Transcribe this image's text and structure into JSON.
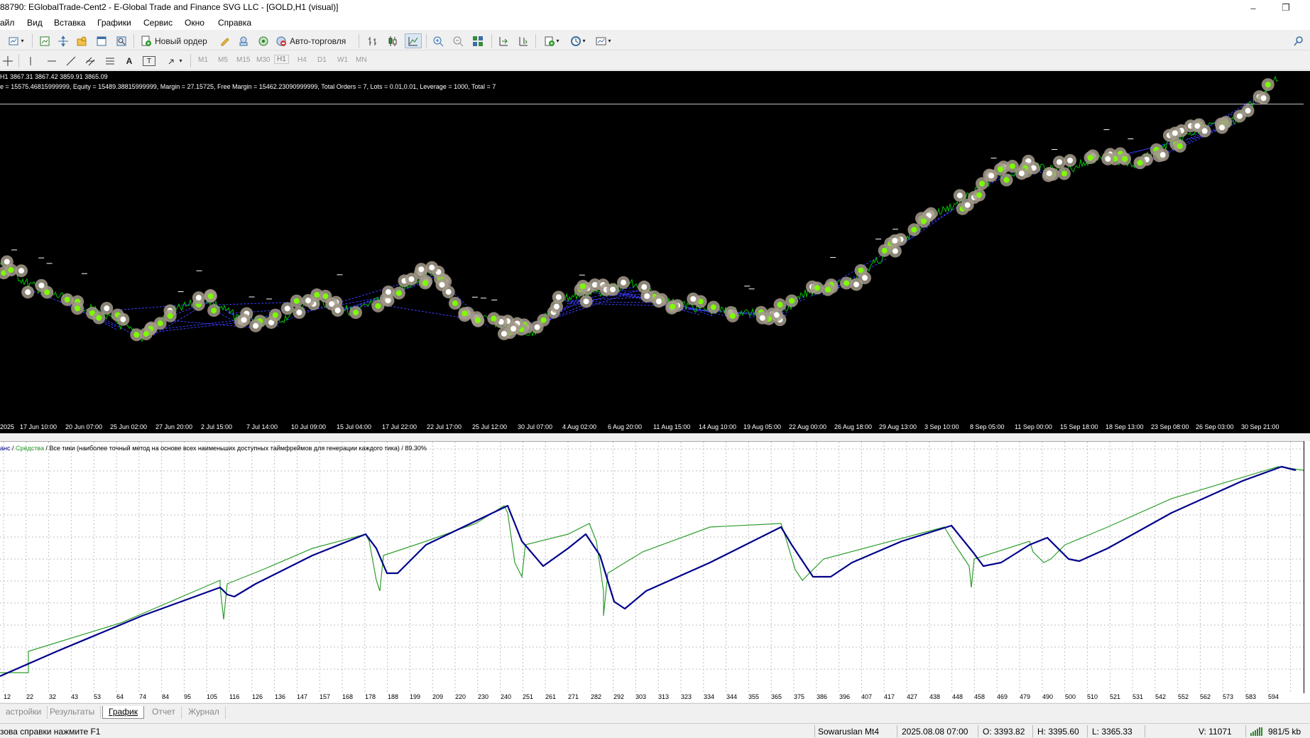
{
  "window": {
    "title": "88790: EGlobalTrade-Cent2 - E-Global Trade and Finance SVG LLC - [GOLD,H1 (visual)]",
    "minimize": "–",
    "restore": "❐"
  },
  "menu": [
    "айл",
    "Вид",
    "Вставка",
    "Графики",
    "Сервис",
    "Окно",
    "Справка"
  ],
  "toolbar": {
    "new_order": "Новый ордер",
    "auto_trading": "Авто-торговля",
    "icons": [
      "new-chart-icon",
      "profiles-icon",
      "market-watch-icon",
      "navigator-icon",
      "data-window-icon",
      "terminal-icon",
      "strategy-tester-icon",
      "meta-editor-icon",
      "bar-chart-icon",
      "candle-chart-icon",
      "line-chart-icon",
      "zoom-in-icon",
      "zoom-out-icon",
      "tile-icon",
      "autoscroll-icon",
      "chart-shift-icon",
      "indicators-icon",
      "periods-icon",
      "templates-icon",
      "search-icon"
    ]
  },
  "drawing_toolbar": {
    "text_tool": "A",
    "label_tool": "T",
    "timeframes": [
      "M1",
      "M5",
      "M15",
      "M30",
      "H1",
      "H4",
      "D1",
      "W1",
      "MN"
    ],
    "active_timeframe": "H1"
  },
  "chart": {
    "ohlc": "H1  3867.31 3867.42 3859.91 3865.09",
    "account_line": "e = 15575.46815999999, Equity = 15489.38815999999, Margin = 27.15725, Free Margin = 15462.23090999999, Total Orders = 7, Lots = 0.01,0.01, Leverage = 1000, Total = 7",
    "time_labels": [
      "2025",
      "17 Jun 10:00",
      "20 Jun 07:00",
      "25 Jun 02:00",
      "27 Jun 20:00",
      "2 Jul 15:00",
      "7 Jul 14:00",
      "10 Jul 09:00",
      "15 Jul 04:00",
      "17 Jul 22:00",
      "22 Jul 17:00",
      "25 Jul 12:00",
      "30 Jul 07:00",
      "4 Aug 02:00",
      "6 Aug 20:00",
      "11 Aug 15:00",
      "14 Aug 10:00",
      "19 Aug 05:00",
      "22 Aug 00:00",
      "26 Aug 18:00",
      "29 Aug 13:00",
      "3 Sep 10:00",
      "8 Sep 05:00",
      "11 Sep 00:00",
      "15 Sep 18:00",
      "18 Sep 13:00",
      "23 Sep 08:00",
      "26 Sep 03:00",
      "30 Sep 21:00"
    ],
    "colors": {
      "background": "#000000",
      "price_line": "#00c000",
      "orders": "#3b3bff",
      "marker": "#a39a8a"
    }
  },
  "equity": {
    "legend_balance": "анс",
    "legend_sep1": " / ",
    "legend_equity": "Средства",
    "legend_rest": " / Все тики (наиболее точный метод на основе всех наименьших доступных таймфреймов для генерации каждого тика) / 89.30%",
    "x_labels": [
      "12",
      "22",
      "32",
      "43",
      "53",
      "64",
      "74",
      "84",
      "95",
      "105",
      "116",
      "126",
      "136",
      "147",
      "157",
      "168",
      "178",
      "188",
      "199",
      "209",
      "220",
      "230",
      "240",
      "251",
      "261",
      "271",
      "282",
      "292",
      "303",
      "313",
      "323",
      "334",
      "344",
      "355",
      "365",
      "375",
      "386",
      "396",
      "407",
      "417",
      "427",
      "438",
      "448",
      "458",
      "469",
      "479",
      "490",
      "500",
      "510",
      "521",
      "531",
      "542",
      "552",
      "562",
      "573",
      "583",
      "594"
    ],
    "colors": {
      "balance": "#00008b",
      "equity": "#2e9e2e"
    }
  },
  "tabs": [
    "астройки",
    "Результаты",
    "График",
    "Отчет",
    "Журнал"
  ],
  "active_tab": "График",
  "status": {
    "help": "зова справки нажмите F1",
    "profile": "Sowaruslan Mt4",
    "datetime": "2025.08.08 07:00",
    "open": "O: 3393.82",
    "high": "H: 3395.60",
    "low": "L: 3365.33",
    "volume": "V: 11071",
    "traffic": "981/5 kb"
  }
}
